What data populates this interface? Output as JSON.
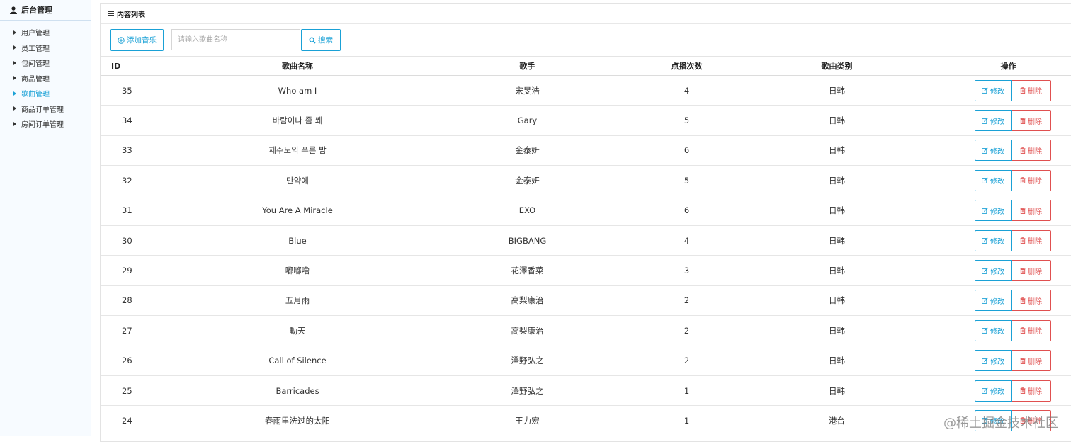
{
  "sidebar": {
    "title": "后台管理",
    "items": [
      {
        "label": "用户管理",
        "active": false
      },
      {
        "label": "员工管理",
        "active": false
      },
      {
        "label": "包间管理",
        "active": false
      },
      {
        "label": "商品管理",
        "active": false
      },
      {
        "label": "歌曲管理",
        "active": true
      },
      {
        "label": "商品订单管理",
        "active": false
      },
      {
        "label": "房间订单管理",
        "active": false
      }
    ]
  },
  "panel": {
    "title": "内容列表"
  },
  "toolbar": {
    "add_label": "添加音乐",
    "search_placeholder": "请输入歌曲名称",
    "search_label": "搜索"
  },
  "table": {
    "headers": {
      "id": "ID",
      "name": "歌曲名称",
      "singer": "歌手",
      "plays": "点播次数",
      "category": "歌曲类别",
      "ops": "操作"
    },
    "edit_label": "修改",
    "delete_label": "删除",
    "rows": [
      {
        "id": "35",
        "name": "Who am I",
        "singer": "宋旻浩",
        "plays": "4",
        "category": "日韩"
      },
      {
        "id": "34",
        "name": "바람이나 좀 쐐",
        "singer": "Gary",
        "plays": "5",
        "category": "日韩"
      },
      {
        "id": "33",
        "name": "제주도의 푸른 밤",
        "singer": "金泰妍",
        "plays": "6",
        "category": "日韩"
      },
      {
        "id": "32",
        "name": "만약에",
        "singer": "金泰妍",
        "plays": "5",
        "category": "日韩"
      },
      {
        "id": "31",
        "name": "You Are A Miracle",
        "singer": "EXO",
        "plays": "6",
        "category": "日韩"
      },
      {
        "id": "30",
        "name": "Blue",
        "singer": "BIGBANG",
        "plays": "4",
        "category": "日韩"
      },
      {
        "id": "29",
        "name": "嘟嘟噜",
        "singer": "花澤香菜",
        "plays": "3",
        "category": "日韩"
      },
      {
        "id": "28",
        "name": "五月雨",
        "singer": "高梨康治",
        "plays": "2",
        "category": "日韩"
      },
      {
        "id": "27",
        "name": "動天",
        "singer": "高梨康治",
        "plays": "2",
        "category": "日韩"
      },
      {
        "id": "26",
        "name": "Call of Silence",
        "singer": "澤野弘之",
        "plays": "2",
        "category": "日韩"
      },
      {
        "id": "25",
        "name": "Barricades",
        "singer": "澤野弘之",
        "plays": "1",
        "category": "日韩"
      },
      {
        "id": "24",
        "name": "春雨里洗过的太阳",
        "singer": "王力宏",
        "plays": "1",
        "category": "港台"
      }
    ]
  },
  "watermark": "@稀土掘金技术社区",
  "colors": {
    "accent": "#1aa1d6",
    "danger": "#e05050",
    "sidebar_bg": "#f7fbff"
  }
}
